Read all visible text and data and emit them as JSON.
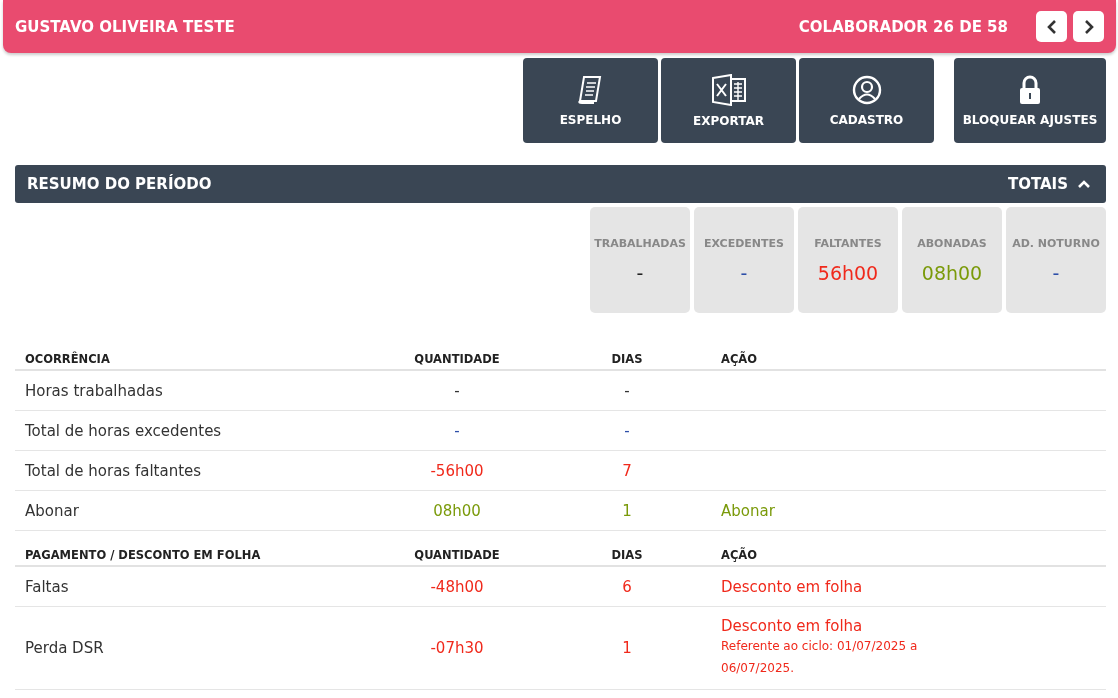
{
  "header": {
    "name": "GUSTAVO OLIVEIRA TESTE",
    "counter": "COLABORADOR 26 DE 58"
  },
  "actions": [
    {
      "label": "ESPELHO",
      "kind": "document"
    },
    {
      "label": "EXPORTAR",
      "kind": "excel"
    },
    {
      "label": "CADASTRO",
      "kind": "user"
    },
    {
      "label": "BLOQUEAR AJUSTES",
      "kind": "lock"
    }
  ],
  "summary": {
    "title": "RESUMO DO PERÍODO",
    "toggle": "TOTAIS",
    "expanded": true,
    "totals": [
      {
        "label": "TRABALHADAS",
        "value": "-",
        "color": "#222222"
      },
      {
        "label": "EXCEDENTES",
        "value": "-",
        "color": "#2d4ea8"
      },
      {
        "label": "FALTANTES",
        "value": "56h00",
        "color": "#f0291b"
      },
      {
        "label": "ABONADAS",
        "value": "08h00",
        "color": "#7a9a0a"
      },
      {
        "label": "AD. NOTURNO",
        "value": "-",
        "color": "#2d4ea8"
      }
    ]
  },
  "tables": [
    {
      "columns": [
        "OCORRÊNCIA",
        "QUANTIDADE",
        "DIAS",
        "AÇÃO"
      ],
      "rows": [
        {
          "name": "Horas trabalhadas",
          "quantity": "-",
          "days": "-",
          "color": "#333333"
        },
        {
          "name": "Total de horas excedentes",
          "quantity": "-",
          "days": "-",
          "color": "#2d4ea8"
        },
        {
          "name": "Total de horas faltantes",
          "quantity": "-56h00",
          "days": "7",
          "color": "#f0291b"
        },
        {
          "name": "Abonar",
          "quantity": "08h00",
          "days": "1",
          "action": "Abonar",
          "color": "#7a9a0a"
        }
      ]
    },
    {
      "columns": [
        "PAGAMENTO / DESCONTO EM FOLHA",
        "QUANTIDADE",
        "DIAS",
        "AÇÃO"
      ],
      "rows": [
        {
          "name": "Faltas",
          "quantity": "-48h00",
          "days": "6",
          "action": "Desconto em folha",
          "color": "#f0291b"
        },
        {
          "name": "Perda DSR",
          "quantity": "-07h30",
          "days": "1",
          "action": "Desconto em folha",
          "note": "Referente ao ciclo: 01/07/2025 a 06/07/2025.",
          "color": "#f0291b"
        }
      ]
    }
  ]
}
